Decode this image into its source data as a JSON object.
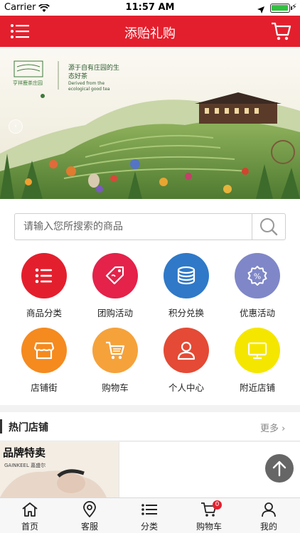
{
  "status_bar": {
    "carrier": "Carrier",
    "time": "11:57 AM"
  },
  "header": {
    "title": "添贻礼购"
  },
  "banner": {
    "slogan_cn": "源于自有庄园的生态好茶",
    "slogan_en": "Derived from the ecological good tea"
  },
  "search": {
    "placeholder": "请输入您所搜索的商品"
  },
  "categories": [
    {
      "label": "商品分类",
      "icon": "list-icon",
      "color": "#e41f2d"
    },
    {
      "label": "团购活动",
      "icon": "tag-icon",
      "color": "#e4224a"
    },
    {
      "label": "积分兑换",
      "icon": "coins-icon",
      "color": "#2f79c8"
    },
    {
      "label": "优惠活动",
      "icon": "percent-icon",
      "color": "#7f87c8"
    },
    {
      "label": "店铺街",
      "icon": "store-icon",
      "color": "#f58a1f"
    },
    {
      "label": "购物车",
      "icon": "cart-icon",
      "color": "#f5a23b"
    },
    {
      "label": "个人中心",
      "icon": "user-icon",
      "color": "#e44a35"
    },
    {
      "label": "附近店铺",
      "icon": "monitor-icon",
      "color": "#f5e600"
    }
  ],
  "hot_shops": {
    "title": "热门店铺",
    "more": "更多"
  },
  "products": {
    "card1_name": "品牌特卖",
    "card1_brand": "GAINKEEL 嘉盛尔"
  },
  "tabbar": {
    "items": [
      {
        "label": "首页",
        "icon": "home-icon"
      },
      {
        "label": "客服",
        "icon": "location-icon"
      },
      {
        "label": "分类",
        "icon": "list-icon"
      },
      {
        "label": "购物车",
        "icon": "cart-icon",
        "badge": "0"
      },
      {
        "label": "我的",
        "icon": "user-icon"
      }
    ]
  },
  "colors": {
    "brand": "#e41f2d"
  }
}
